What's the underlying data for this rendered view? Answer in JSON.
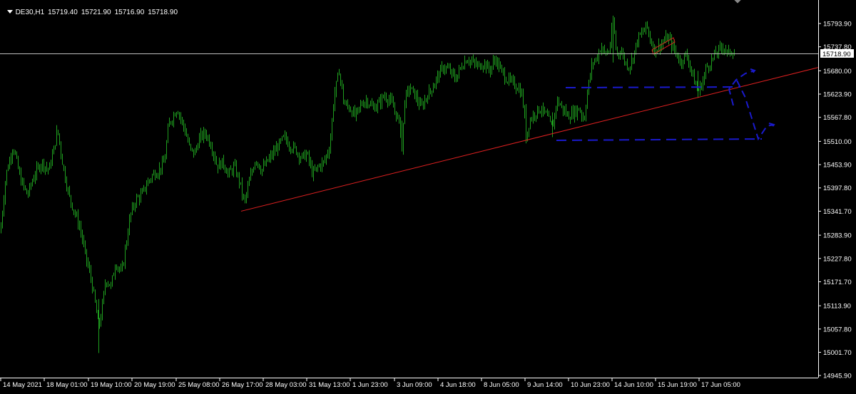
{
  "header": {
    "symbol": "DE30,H1",
    "open": "15719.40",
    "high": "15721.90",
    "low": "15716.90",
    "close": "15718.90"
  },
  "colors": {
    "background": "#000000",
    "candle": "#1fa01f",
    "trendline": "#e02020",
    "drawing": "#1a1acc",
    "axis": "#ffffff"
  },
  "chart_data": {
    "type": "candlestick",
    "symbol": "DE30",
    "timeframe": "H1",
    "current_price": 15718.9,
    "y_ticks": [
      15793.9,
      15737.8,
      15680.0,
      15623.9,
      15567.8,
      15510.0,
      15453.9,
      15397.8,
      15341.7,
      15283.9,
      15227.8,
      15171.7,
      15113.9,
      15057.8,
      15001.7,
      14945.9
    ],
    "y_tick_labels": [
      "15793.90",
      "15737.80",
      "15680.00",
      "15623.90",
      "15567.80",
      "15510.00",
      "15453.90",
      "15397.80",
      "15341.70",
      "15283.90",
      "15227.80",
      "15171.70",
      "15113.90",
      "15057.80",
      "15001.70",
      "14945.90"
    ],
    "ylim": [
      14940,
      15825
    ],
    "x_labels": [
      "14 May 2021",
      "18 May 01:00",
      "19 May 10:00",
      "20 May 19:00",
      "25 May 08:00",
      "26 May 17:00",
      "28 May 03:00",
      "31 May 13:00",
      "1 Jun 23:00",
      "3 Jun 09:00",
      "4 Jun 18:00",
      "8 Jun 05:00",
      "9 Jun 14:00",
      "10 Jun 23:00",
      "14 Jun 10:00",
      "15 Jun 19:00",
      "17 Jun 05:00"
    ],
    "price_series": [
      {
        "x": 0,
        "y": 15290
      },
      {
        "x": 8,
        "y": 15430
      },
      {
        "x": 18,
        "y": 15500
      },
      {
        "x": 28,
        "y": 15420
      },
      {
        "x": 38,
        "y": 15380
      },
      {
        "x": 48,
        "y": 15430
      },
      {
        "x": 58,
        "y": 15460
      },
      {
        "x": 68,
        "y": 15440
      },
      {
        "x": 75,
        "y": 15490
      },
      {
        "x": 80,
        "y": 15540
      },
      {
        "x": 88,
        "y": 15450
      },
      {
        "x": 96,
        "y": 15380
      },
      {
        "x": 104,
        "y": 15340
      },
      {
        "x": 112,
        "y": 15300
      },
      {
        "x": 120,
        "y": 15230
      },
      {
        "x": 127,
        "y": 15180
      },
      {
        "x": 133,
        "y": 15120
      },
      {
        "x": 138,
        "y": 15060
      },
      {
        "x": 142,
        "y": 15100
      },
      {
        "x": 148,
        "y": 15180
      },
      {
        "x": 155,
        "y": 15160
      },
      {
        "x": 162,
        "y": 15220
      },
      {
        "x": 170,
        "y": 15190
      },
      {
        "x": 176,
        "y": 15260
      },
      {
        "x": 182,
        "y": 15330
      },
      {
        "x": 190,
        "y": 15370
      },
      {
        "x": 198,
        "y": 15380
      },
      {
        "x": 206,
        "y": 15410
      },
      {
        "x": 214,
        "y": 15430
      },
      {
        "x": 222,
        "y": 15440
      },
      {
        "x": 230,
        "y": 15460
      },
      {
        "x": 236,
        "y": 15550
      },
      {
        "x": 242,
        "y": 15570
      },
      {
        "x": 248,
        "y": 15590
      },
      {
        "x": 254,
        "y": 15560
      },
      {
        "x": 260,
        "y": 15530
      },
      {
        "x": 266,
        "y": 15490
      },
      {
        "x": 272,
        "y": 15480
      },
      {
        "x": 280,
        "y": 15520
      },
      {
        "x": 288,
        "y": 15530
      },
      {
        "x": 296,
        "y": 15500
      },
      {
        "x": 304,
        "y": 15450
      },
      {
        "x": 312,
        "y": 15460
      },
      {
        "x": 320,
        "y": 15430
      },
      {
        "x": 328,
        "y": 15450
      },
      {
        "x": 336,
        "y": 15410
      },
      {
        "x": 342,
        "y": 15360
      },
      {
        "x": 350,
        "y": 15420
      },
      {
        "x": 358,
        "y": 15470
      },
      {
        "x": 366,
        "y": 15440
      },
      {
        "x": 374,
        "y": 15460
      },
      {
        "x": 382,
        "y": 15480
      },
      {
        "x": 390,
        "y": 15500
      },
      {
        "x": 398,
        "y": 15520
      },
      {
        "x": 406,
        "y": 15500
      },
      {
        "x": 414,
        "y": 15490
      },
      {
        "x": 422,
        "y": 15470
      },
      {
        "x": 430,
        "y": 15480
      },
      {
        "x": 438,
        "y": 15430
      },
      {
        "x": 446,
        "y": 15450
      },
      {
        "x": 454,
        "y": 15460
      },
      {
        "x": 462,
        "y": 15500
      },
      {
        "x": 468,
        "y": 15620
      },
      {
        "x": 475,
        "y": 15680
      },
      {
        "x": 482,
        "y": 15600
      },
      {
        "x": 490,
        "y": 15590
      },
      {
        "x": 498,
        "y": 15570
      },
      {
        "x": 506,
        "y": 15600
      },
      {
        "x": 514,
        "y": 15610
      },
      {
        "x": 522,
        "y": 15590
      },
      {
        "x": 530,
        "y": 15600
      },
      {
        "x": 538,
        "y": 15620
      },
      {
        "x": 546,
        "y": 15610
      },
      {
        "x": 554,
        "y": 15580
      },
      {
        "x": 560,
        "y": 15550
      },
      {
        "x": 563,
        "y": 15490
      },
      {
        "x": 567,
        "y": 15610
      },
      {
        "x": 574,
        "y": 15640
      },
      {
        "x": 582,
        "y": 15620
      },
      {
        "x": 590,
        "y": 15590
      },
      {
        "x": 598,
        "y": 15620
      },
      {
        "x": 606,
        "y": 15640
      },
      {
        "x": 614,
        "y": 15670
      },
      {
        "x": 622,
        "y": 15690
      },
      {
        "x": 630,
        "y": 15680
      },
      {
        "x": 638,
        "y": 15660
      },
      {
        "x": 646,
        "y": 15690
      },
      {
        "x": 654,
        "y": 15710
      },
      {
        "x": 662,
        "y": 15700
      },
      {
        "x": 670,
        "y": 15690
      },
      {
        "x": 678,
        "y": 15700
      },
      {
        "x": 686,
        "y": 15680
      },
      {
        "x": 694,
        "y": 15710
      },
      {
        "x": 702,
        "y": 15680
      },
      {
        "x": 710,
        "y": 15660
      },
      {
        "x": 718,
        "y": 15650
      },
      {
        "x": 726,
        "y": 15640
      },
      {
        "x": 732,
        "y": 15620
      },
      {
        "x": 737,
        "y": 15520
      },
      {
        "x": 742,
        "y": 15560
      },
      {
        "x": 750,
        "y": 15580
      },
      {
        "x": 758,
        "y": 15590
      },
      {
        "x": 766,
        "y": 15570
      },
      {
        "x": 774,
        "y": 15540
      },
      {
        "x": 780,
        "y": 15610
      },
      {
        "x": 788,
        "y": 15590
      },
      {
        "x": 796,
        "y": 15570
      },
      {
        "x": 804,
        "y": 15580
      },
      {
        "x": 812,
        "y": 15590
      },
      {
        "x": 818,
        "y": 15560
      },
      {
        "x": 824,
        "y": 15640
      },
      {
        "x": 830,
        "y": 15700
      },
      {
        "x": 836,
        "y": 15710
      },
      {
        "x": 842,
        "y": 15740
      },
      {
        "x": 848,
        "y": 15720
      },
      {
        "x": 854,
        "y": 15730
      },
      {
        "x": 859,
        "y": 15800
      },
      {
        "x": 864,
        "y": 15720
      },
      {
        "x": 870,
        "y": 15730
      },
      {
        "x": 876,
        "y": 15700
      },
      {
        "x": 882,
        "y": 15690
      },
      {
        "x": 888,
        "y": 15720
      },
      {
        "x": 894,
        "y": 15760
      },
      {
        "x": 900,
        "y": 15770
      },
      {
        "x": 906,
        "y": 15790
      },
      {
        "x": 912,
        "y": 15750
      },
      {
        "x": 918,
        "y": 15730
      },
      {
        "x": 924,
        "y": 15740
      },
      {
        "x": 930,
        "y": 15750
      },
      {
        "x": 936,
        "y": 15760
      },
      {
        "x": 942,
        "y": 15740
      },
      {
        "x": 948,
        "y": 15720
      },
      {
        "x": 954,
        "y": 15700
      },
      {
        "x": 960,
        "y": 15720
      },
      {
        "x": 966,
        "y": 15700
      },
      {
        "x": 972,
        "y": 15660
      },
      {
        "x": 978,
        "y": 15630
      },
      {
        "x": 984,
        "y": 15650
      },
      {
        "x": 990,
        "y": 15690
      },
      {
        "x": 996,
        "y": 15700
      },
      {
        "x": 1002,
        "y": 15720
      },
      {
        "x": 1008,
        "y": 15730
      },
      {
        "x": 1014,
        "y": 15740
      },
      {
        "x": 1020,
        "y": 15720
      },
      {
        "x": 1026,
        "y": 15730
      },
      {
        "x": 1030,
        "y": 15718.9
      }
    ],
    "annotations": [
      {
        "type": "trendline",
        "color": "#e02020",
        "from": {
          "x": 338,
          "y": 15341.7
        },
        "to": {
          "x": 1147,
          "y": 15688
        }
      },
      {
        "type": "small-channel",
        "color": "#e02020"
      },
      {
        "type": "dashed-line",
        "color": "#1a1acc",
        "label": ""
      },
      {
        "type": "dashed-line",
        "color": "#1a1acc",
        "label": ""
      },
      {
        "type": "dashed-path",
        "color": "#1a1acc",
        "label": ""
      }
    ],
    "grid": false,
    "legend": "none"
  }
}
